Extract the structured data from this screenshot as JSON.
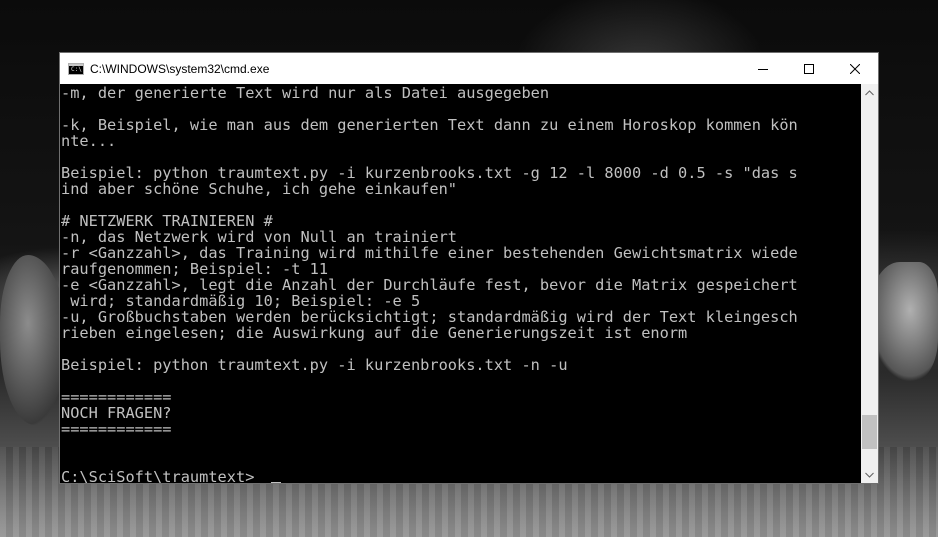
{
  "window": {
    "title": "C:\\WINDOWS\\system32\\cmd.exe",
    "icon": "cmd-icon",
    "controls": {
      "minimize_icon": "minimize-icon",
      "maximize_icon": "maximize-icon",
      "close_icon": "close-icon"
    }
  },
  "console": {
    "foreground": "#c0c0c0",
    "background": "#000000",
    "lines": [
      "-m, der generierte Text wird nur als Datei ausgegeben",
      "",
      "-k, Beispiel, wie man aus dem generierten Text dann zu einem Horoskop kommen kön",
      "nte...",
      "",
      "Beispiel: python traumtext.py -i kurzenbrooks.txt -g 12 -l 8000 -d 0.5 -s \"das s",
      "ind aber schöne Schuhe, ich gehe einkaufen\"",
      "",
      "# NETZWERK TRAINIEREN #",
      "-n, das Netzwerk wird von Null an trainiert",
      "-r <Ganzzahl>, das Training wird mithilfe einer bestehenden Gewichtsmatrix wiede",
      "raufgenommen; Beispiel: -t 11",
      "-e <Ganzzahl>, legt die Anzahl der Durchläufe fest, bevor die Matrix gespeichert",
      " wird; standardmäßig 10; Beispiel: -e 5",
      "-u, Großbuchstaben werden berücksichtigt; standardmäßig wird der Text kleingesch",
      "rieben eingelesen; die Auswirkung auf die Generierungszeit ist enorm",
      "",
      "Beispiel: python traumtext.py -i kurzenbrooks.txt -n -u",
      "",
      "============",
      "NOCH FRAGEN?",
      "============",
      "",
      "",
      "C:\\SciSoft\\traumtext>"
    ]
  },
  "scrollbar": {
    "position": 0.95,
    "up_icon": "scroll-up-arrow-icon",
    "down_icon": "scroll-down-arrow-icon"
  }
}
